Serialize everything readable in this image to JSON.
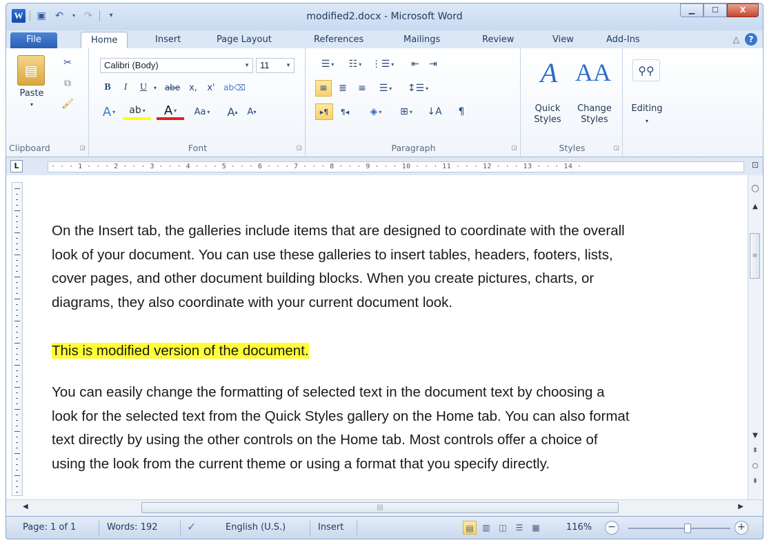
{
  "window": {
    "title": "modified2.docx - Microsoft Word",
    "app_icon": "word-logo-icon",
    "quick_access": [
      "save-icon",
      "undo-icon",
      "redo-icon",
      "customize-icon"
    ],
    "controls": {
      "minimize": "▁",
      "maximize": "☐",
      "close": "X"
    }
  },
  "ribbon_tabs": {
    "file": "File",
    "tabs": [
      "Home",
      "Insert",
      "Page Layout",
      "References",
      "Mailings",
      "Review",
      "View",
      "Add-Ins"
    ],
    "active": "Home"
  },
  "clipboard": {
    "paste": "Paste",
    "label": "Clipboard"
  },
  "font": {
    "name": "Calibri (Body)",
    "size": "11",
    "bold": "B",
    "italic": "I",
    "underline": "U",
    "strike": "abe",
    "subscript": "x,",
    "superscript": "x'",
    "change_case": "Aa",
    "grow": "A",
    "shrink": "A",
    "label": "Font"
  },
  "paragraph": {
    "label": "Paragraph",
    "show_marks": "¶"
  },
  "styles": {
    "quick_styles": "Quick\nStyles",
    "change_styles": "Change\nStyles",
    "label": "Styles"
  },
  "editing": {
    "label": "Editing"
  },
  "ruler": {
    "ticks": "· · · 1 · · · 2 · · · 3 · · · 4 · · · 5 · · · 6 · · · 7 · · · 8 · · · 9 · · · 10 · · · 11 · · · 12 · · · 13 · · · 14 ·"
  },
  "document": {
    "paragraphs": [
      [
        "On the Insert tab, the galleries include items that are designed to coordinate with the overall",
        "look of your document. You can use these galleries to insert tables, headers, footers, lists,",
        "cover pages, and other document building blocks. When you create pictures, charts, or",
        "diagrams, they also coordinate with your current document look."
      ],
      [
        "This is modified version of the document."
      ],
      [
        "You can easily change the formatting of selected text in the document text by choosing a",
        "look for the selected text from the Quick Styles gallery on the Home tab. You can also format",
        "text directly by using the other controls on the Home tab. Most controls offer a choice of",
        "using the look from the current theme or using a format that you specify directly."
      ]
    ],
    "highlight_color": "#ffff33"
  },
  "status": {
    "page": "Page: 1 of 1",
    "words": "Words: 192",
    "language": "English (U.S.)",
    "mode": "Insert",
    "zoom": "116%",
    "zoom_level_fraction": 0.58
  }
}
